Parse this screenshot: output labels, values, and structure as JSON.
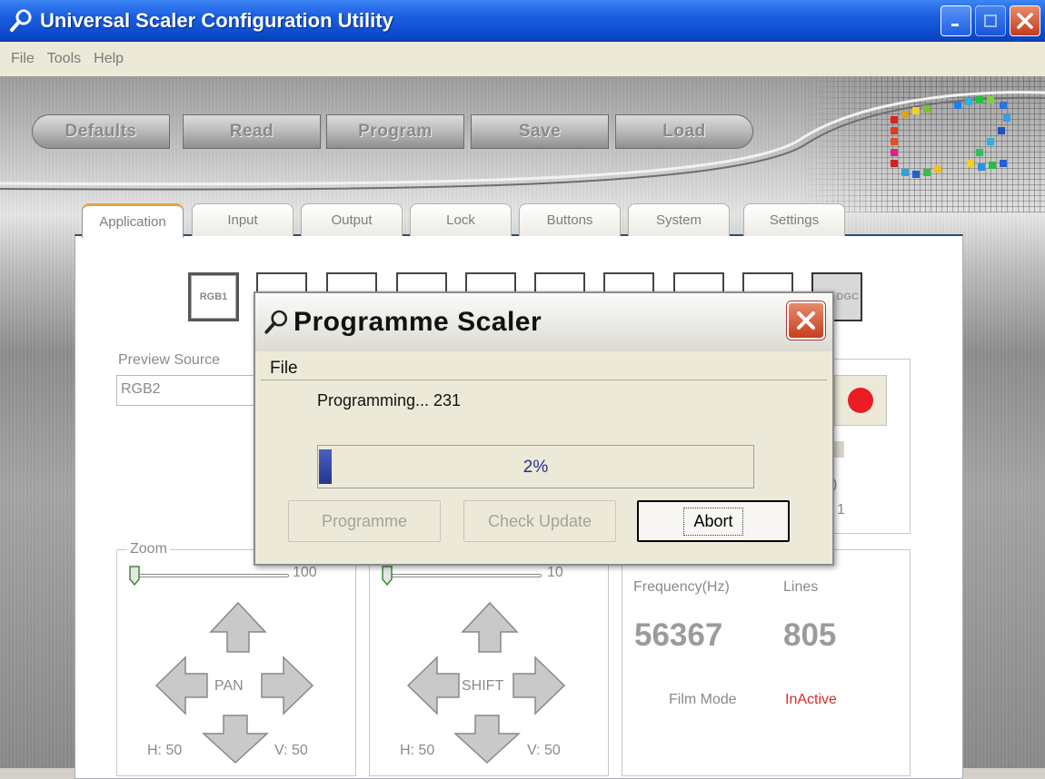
{
  "window": {
    "title": "Universal Scaler Configuration Utility"
  },
  "menu": [
    "File",
    "Tools",
    "Help"
  ],
  "toolbar": [
    "Defaults",
    "Read",
    "Program",
    "Save",
    "Load"
  ],
  "tabs": [
    "Application",
    "Input",
    "Output",
    "Lock",
    "Buttons",
    "System",
    "Settings"
  ],
  "sources": {
    "first_label": "RGB1",
    "last_label": "DGC"
  },
  "preview": {
    "label": "Preview Source",
    "value": "RGB2"
  },
  "partial_digits": {
    "a": ")",
    "b": "1"
  },
  "zoom": {
    "label": "Zoom",
    "slider_max": "100",
    "pan_label": "PAN",
    "h": "H: 50",
    "v": "V: 50"
  },
  "shift": {
    "slider_max": "10",
    "label": "SHIFT",
    "h": "H: 50",
    "v": "V: 50"
  },
  "signal": {
    "freq_label": "Frequency(Hz)",
    "lines_label": "Lines",
    "freq_value": "56367",
    "lines_value": "805",
    "film_label": "Film Mode",
    "film_value": "InActive"
  },
  "dialog": {
    "title": "Programme Scaler",
    "menu": "File",
    "status": "Programming... 231",
    "progress_value": 2,
    "progress_text": "2%",
    "buttons": {
      "programme": "Programme",
      "check_update": "Check Update",
      "abort": "Abort"
    }
  },
  "colors": {
    "titlebar": "#0c49c9",
    "progress": "#25368f",
    "inactive_red": "#d62c2c",
    "record_red": "#ec1c24"
  }
}
